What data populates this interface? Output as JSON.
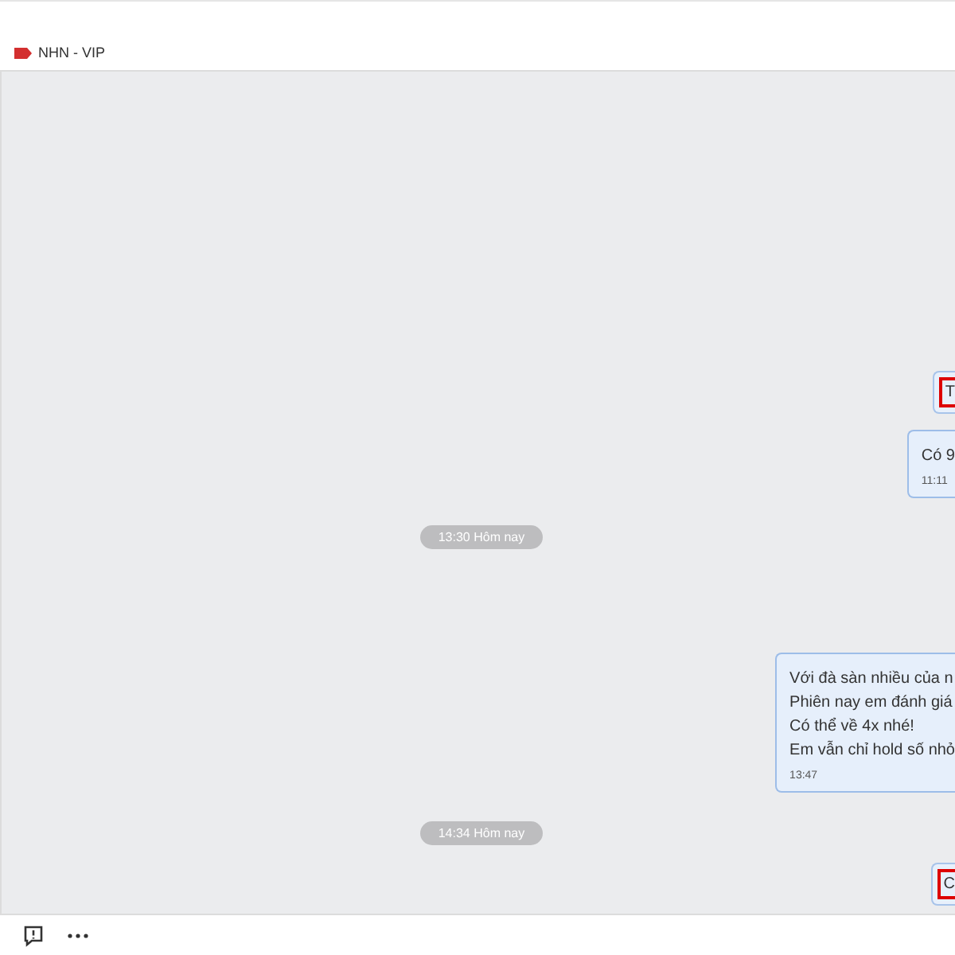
{
  "header": {
    "tag": {
      "label": "NHN - VIP",
      "color": "#d32f2f"
    }
  },
  "messages": [
    {
      "kind": "marked",
      "text": "T"
    },
    {
      "kind": "bubble",
      "lines": [
        "Có 9"
      ],
      "time": "11:11"
    },
    {
      "kind": "date",
      "text": "13:30 Hôm nay"
    },
    {
      "kind": "bubble",
      "lines": [
        "Với đà sàn nhiều của n",
        "Phiên nay em đánh giá",
        "Có thể về 4x nhé!",
        "Em vẫn chỉ hold số nhỏ"
      ],
      "time": "13:47"
    },
    {
      "kind": "date",
      "text": "14:34 Hôm nay"
    },
    {
      "kind": "marked",
      "text": "C"
    }
  ]
}
